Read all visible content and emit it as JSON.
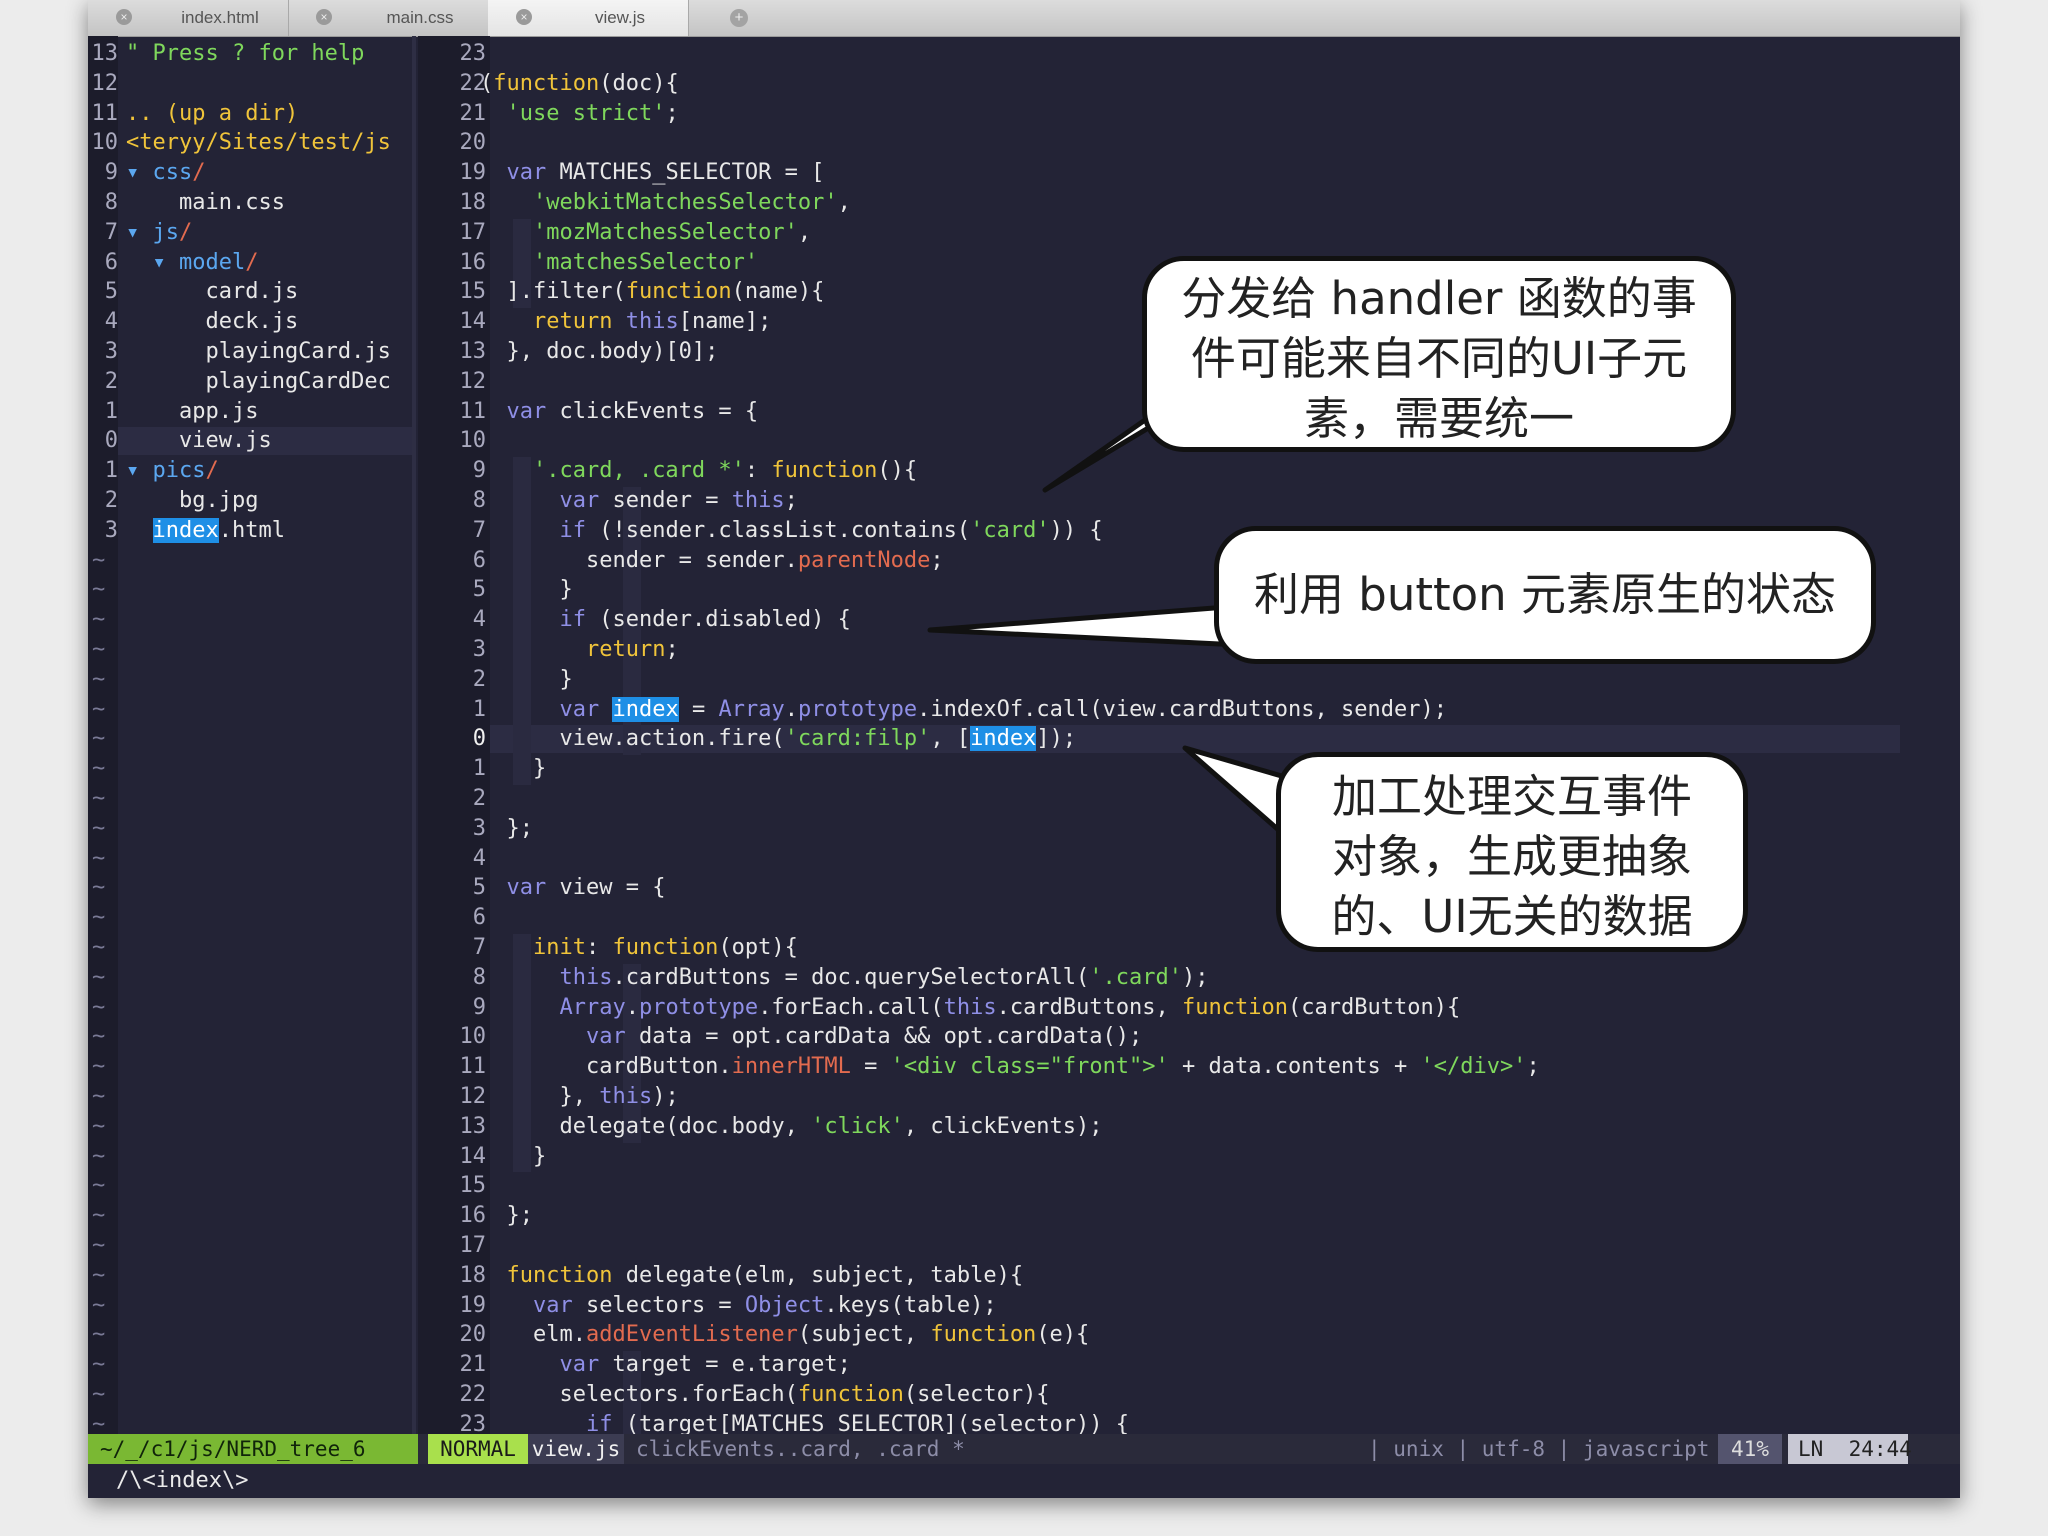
{
  "tabs": [
    {
      "label": "index.html",
      "active": false
    },
    {
      "label": "main.css",
      "active": false
    },
    {
      "label": "view.js",
      "active": true
    }
  ],
  "tree_lines": [
    {
      "num": "13",
      "text": "\" Press ? for help"
    },
    {
      "num": "12",
      "text": ""
    },
    {
      "num": "11",
      "text": ".. (up a dir)"
    },
    {
      "num": "10",
      "text": "<teryy/Sites/test/js"
    },
    {
      "num": "9",
      "text": "▾ css/"
    },
    {
      "num": "8",
      "text": "    main.css"
    },
    {
      "num": "7",
      "text": "▾ js/"
    },
    {
      "num": "6",
      "text": "  ▾ model/"
    },
    {
      "num": "5",
      "text": "      card.js"
    },
    {
      "num": "4",
      "text": "      deck.js"
    },
    {
      "num": "3",
      "text": "      playingCard.js"
    },
    {
      "num": "2",
      "text": "      playingCardDec"
    },
    {
      "num": "1",
      "text": "    app.js"
    },
    {
      "num": "0",
      "text": "    view.js"
    },
    {
      "num": "1",
      "text": "▾ pics/"
    },
    {
      "num": "2",
      "text": "    bg.jpg"
    },
    {
      "num": "3",
      "text": "  index.html"
    }
  ],
  "code_line_numbers": [
    "23",
    "22",
    "21",
    "20",
    "19",
    "18",
    "17",
    "16",
    "15",
    "14",
    "13",
    "12",
    "11",
    "10",
    "9",
    "8",
    "7",
    "6",
    "5",
    "4",
    "3",
    "2",
    "1",
    "0",
    "1",
    "2",
    "3",
    "4",
    "5",
    "6",
    "7",
    "8",
    "9",
    "10",
    "11",
    "12",
    "13",
    "14",
    "15",
    "16",
    "17",
    "18",
    "19",
    "20",
    "21",
    "22",
    "23"
  ],
  "code_lines": [
    "",
    "(function(doc){",
    "  'use strict';",
    "",
    "  var MATCHES_SELECTOR = [",
    "    'webkitMatchesSelector',",
    "    'mozMatchesSelector',",
    "    'matchesSelector'",
    "  ].filter(function(name){",
    "    return this[name];",
    "  }, doc.body)[0];",
    "",
    "  var clickEvents = {",
    "",
    "    '.card, .card *': function(){",
    "      var sender = this;",
    "      if (!sender.classList.contains('card')) {",
    "        sender = sender.parentNode;",
    "      }",
    "      if (sender.disabled) {",
    "        return;",
    "      }",
    "      var index = Array.prototype.indexOf.call(view.cardButtons, sender);",
    "      view.action.fire('card:filp', [index]);",
    "    }",
    "",
    "  };",
    "",
    "  var view = {",
    "",
    "    init: function(opt){",
    "      this.cardButtons = doc.querySelectorAll('.card');",
    "      Array.prototype.forEach.call(this.cardButtons, function(cardButton){",
    "        var data = opt.cardData && opt.cardData();",
    "        cardButton.innerHTML = '<div class=\"front\">' + data.contents + '</div>';",
    "      }, this);",
    "      delegate(doc.body, 'click', clickEvents);",
    "    }",
    "",
    "  };",
    "",
    "  function delegate(elm, subject, table){",
    "    var selectors = Object.keys(table);",
    "    elm.addEventListener(subject, function(e){",
    "      var target = e.target;",
    "      selectors.forEach(function(selector){",
    "        if (target[MATCHES_SELECTOR](selector)) {"
  ],
  "status": {
    "path": "~/_/c1/js/NERD_tree_6",
    "mode": "NORMAL",
    "file": "view.js",
    "context": "clickEvents..card, .card *",
    "fileinfo": "| unix | utf-8 | javascript",
    "percent": "41%",
    "ln_label": "LN",
    "position": "24:44"
  },
  "command_line": "/\\<index\\>",
  "callouts": [
    {
      "text_lines": [
        "分发给 handler 函数的事",
        "件可能来自不同的UI子元",
        "素，需要统一"
      ]
    },
    {
      "text_lines": [
        "利用 button 元素原生的状态"
      ]
    },
    {
      "text_lines": [
        "加工处理交互事件",
        "对象，生成更抽象",
        "的、UI无关的数据"
      ]
    }
  ]
}
